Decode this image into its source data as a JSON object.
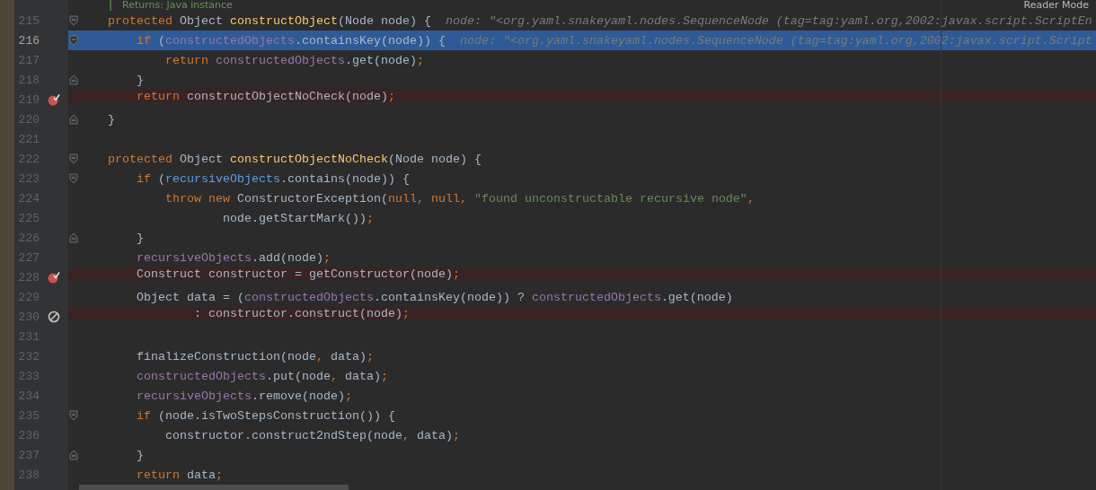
{
  "doc_hint": {
    "text": "Returns: Java instance"
  },
  "reader_mode": "Reader Mode",
  "lines": [
    {
      "number": "215",
      "current": false,
      "fold": {
        "kind": "start"
      },
      "tokens": [
        {
          "t": "protected",
          "kind": "kw"
        },
        {
          "t": " Object ",
          "kind": "plain"
        },
        {
          "t": "constructObject",
          "kind": "decl"
        },
        {
          "t": "(Node node) {",
          "kind": "plain"
        }
      ],
      "hint": "node: \"<org.yaml.snakeyaml.nodes.SequenceNode (tag=tag:yaml.org,2002:javax.script.ScriptEn"
    },
    {
      "number": "216",
      "current": true,
      "fold": {
        "kind": "start"
      },
      "tokens": [
        {
          "t": "    if",
          "kind": "kw"
        },
        {
          "t": " (",
          "kind": "plain"
        },
        {
          "t": "constructedObjects",
          "kind": "field"
        },
        {
          "t": ".containsKey(node)) {",
          "kind": "plain"
        }
      ],
      "hint": "node: \"<org.yaml.snakeyaml.nodes.SequenceNode (tag=tag:yaml.org,2002:javax.script.Script"
    },
    {
      "number": "217",
      "current": false,
      "tokens": [
        {
          "t": "        return",
          "kind": "kw"
        },
        {
          "t": " constructedObjects",
          "kind": "field"
        },
        {
          "t": ".get(node)",
          "kind": "plain"
        },
        {
          "t": ";",
          "kind": "punct"
        }
      ]
    },
    {
      "number": "218",
      "current": false,
      "fold": {
        "kind": "end"
      },
      "tokens": [
        {
          "t": "    }",
          "kind": "plain"
        }
      ]
    },
    {
      "number": "219",
      "current": false,
      "breakpoint": {
        "kind": "verified"
      },
      "tokens": [
        {
          "t": "    return",
          "kind": "kw"
        },
        {
          "t": " constructObjectNoCheck(node)",
          "kind": "plain"
        },
        {
          "t": ";",
          "kind": "punct"
        }
      ]
    },
    {
      "number": "220",
      "current": false,
      "fold": {
        "kind": "end"
      },
      "tokens": [
        {
          "t": "}",
          "kind": "plain"
        }
      ]
    },
    {
      "number": "221",
      "current": false
    },
    {
      "number": "222",
      "current": false,
      "fold": {
        "kind": "start"
      },
      "tokens": [
        {
          "t": "protected",
          "kind": "kw"
        },
        {
          "t": " Object ",
          "kind": "plain"
        },
        {
          "t": "constructObjectNoCheck",
          "kind": "decl"
        },
        {
          "t": "(Node node) {",
          "kind": "plain"
        }
      ]
    },
    {
      "number": "223",
      "current": false,
      "fold": {
        "kind": "start"
      },
      "tokens": [
        {
          "t": "    if",
          "kind": "kw"
        },
        {
          "t": " (",
          "kind": "plain"
        },
        {
          "t": "recursiveObjects",
          "kind": "usage"
        },
        {
          "t": ".contains(node)) {",
          "kind": "plain"
        }
      ]
    },
    {
      "number": "224",
      "current": false,
      "tokens": [
        {
          "t": "        throw new",
          "kind": "kw"
        },
        {
          "t": " ConstructorException(",
          "kind": "plain"
        },
        {
          "t": "null, null, ",
          "kind": "kw"
        },
        {
          "t": "\"found unconstructable recursive node\"",
          "kind": "str"
        },
        {
          "t": ",",
          "kind": "punct"
        }
      ]
    },
    {
      "number": "225",
      "current": false,
      "tokens": [
        {
          "t": "                node.getStartMark())",
          "kind": "plain"
        },
        {
          "t": ";",
          "kind": "punct"
        }
      ]
    },
    {
      "number": "226",
      "current": false,
      "fold": {
        "kind": "end"
      },
      "tokens": [
        {
          "t": "    }",
          "kind": "plain"
        }
      ]
    },
    {
      "number": "227",
      "current": false,
      "tokens": [
        {
          "t": "    recursiveObjects",
          "kind": "field"
        },
        {
          "t": ".add(node)",
          "kind": "plain"
        },
        {
          "t": ";",
          "kind": "punct"
        }
      ]
    },
    {
      "number": "228",
      "current": false,
      "breakpoint": {
        "kind": "verified"
      },
      "tokens": [
        {
          "t": "    Construct constructor = getConstructor(node)",
          "kind": "plain"
        },
        {
          "t": ";",
          "kind": "punct"
        }
      ]
    },
    {
      "number": "229",
      "current": false,
      "tokens": [
        {
          "t": "    Object data = (",
          "kind": "plain"
        },
        {
          "t": "constructedObjects",
          "kind": "field"
        },
        {
          "t": ".containsKey(node)) ? ",
          "kind": "plain"
        },
        {
          "t": "constructedObjects",
          "kind": "field"
        },
        {
          "t": ".get(node)",
          "kind": "plain"
        }
      ]
    },
    {
      "number": "230",
      "current": false,
      "breakpoint": {
        "kind": "disabled"
      },
      "tokens": [
        {
          "t": "            : constructor.construct(node)",
          "kind": "plain"
        },
        {
          "t": ";",
          "kind": "punct"
        }
      ]
    },
    {
      "number": "231",
      "current": false
    },
    {
      "number": "232",
      "current": false,
      "tokens": [
        {
          "t": "    finalizeConstruction(node",
          "kind": "plain"
        },
        {
          "t": ",",
          "kind": "punct"
        },
        {
          "t": " data)",
          "kind": "plain"
        },
        {
          "t": ";",
          "kind": "punct"
        }
      ]
    },
    {
      "number": "233",
      "current": false,
      "tokens": [
        {
          "t": "    constructedObjects",
          "kind": "field"
        },
        {
          "t": ".put(node",
          "kind": "plain"
        },
        {
          "t": ",",
          "kind": "punct"
        },
        {
          "t": " data)",
          "kind": "plain"
        },
        {
          "t": ";",
          "kind": "punct"
        }
      ]
    },
    {
      "number": "234",
      "current": false,
      "tokens": [
        {
          "t": "    recursiveObjects",
          "kind": "field"
        },
        {
          "t": ".remove(node)",
          "kind": "plain"
        },
        {
          "t": ";",
          "kind": "punct"
        }
      ]
    },
    {
      "number": "235",
      "current": false,
      "fold": {
        "kind": "start"
      },
      "tokens": [
        {
          "t": "    if",
          "kind": "kw"
        },
        {
          "t": " (node.isTwoStepsConstruction()) {",
          "kind": "plain"
        }
      ]
    },
    {
      "number": "236",
      "current": false,
      "tokens": [
        {
          "t": "        constructor.construct2ndStep(node",
          "kind": "plain"
        },
        {
          "t": ",",
          "kind": "punct"
        },
        {
          "t": " data)",
          "kind": "plain"
        },
        {
          "t": ";",
          "kind": "punct"
        }
      ]
    },
    {
      "number": "237",
      "current": false,
      "fold": {
        "kind": "end"
      },
      "tokens": [
        {
          "t": "    }",
          "kind": "plain"
        }
      ]
    },
    {
      "number": "238",
      "current": false,
      "tokens": [
        {
          "t": "    return",
          "kind": "kw"
        },
        {
          "t": " data",
          "kind": "plain"
        },
        {
          "t": ";",
          "kind": "punct"
        }
      ]
    }
  ]
}
